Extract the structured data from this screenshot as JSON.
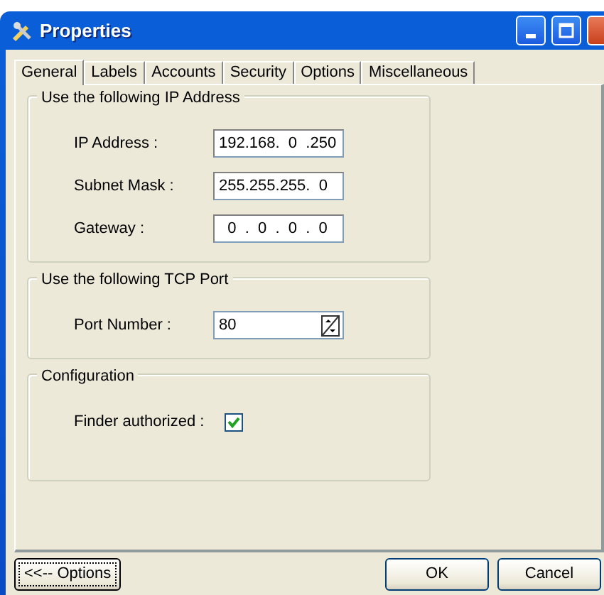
{
  "window": {
    "title": "Properties"
  },
  "tabs": [
    {
      "label": "General",
      "selected": true
    },
    {
      "label": "Labels",
      "selected": false
    },
    {
      "label": "Accounts",
      "selected": false
    },
    {
      "label": "Security",
      "selected": false
    },
    {
      "label": "Options",
      "selected": false
    },
    {
      "label": "Miscellaneous",
      "selected": false
    }
  ],
  "groups": [
    {
      "title": "Use the following IP Address",
      "rows": [
        {
          "kind": "ip",
          "label": "IP Address :",
          "value": "192.168.  0  .250"
        },
        {
          "kind": "ip",
          "label": "Subnet Mask :",
          "value": "255.255.255.  0"
        },
        {
          "kind": "ip",
          "label": "Gateway :",
          "value": "  0  .  0  .  0  .  0"
        }
      ]
    },
    {
      "title": "Use the following TCP Port",
      "rows": [
        {
          "kind": "spin",
          "label": "Port Number :",
          "value": "80"
        }
      ]
    },
    {
      "title": "Configuration",
      "rows": [
        {
          "kind": "checkbox",
          "label": "Finder authorized :",
          "checked": true
        }
      ]
    }
  ],
  "buttons": [
    {
      "label": "<<-- Options",
      "focused": true
    },
    {
      "label": "OK",
      "focused": false
    },
    {
      "label": "Cancel",
      "focused": false
    }
  ]
}
